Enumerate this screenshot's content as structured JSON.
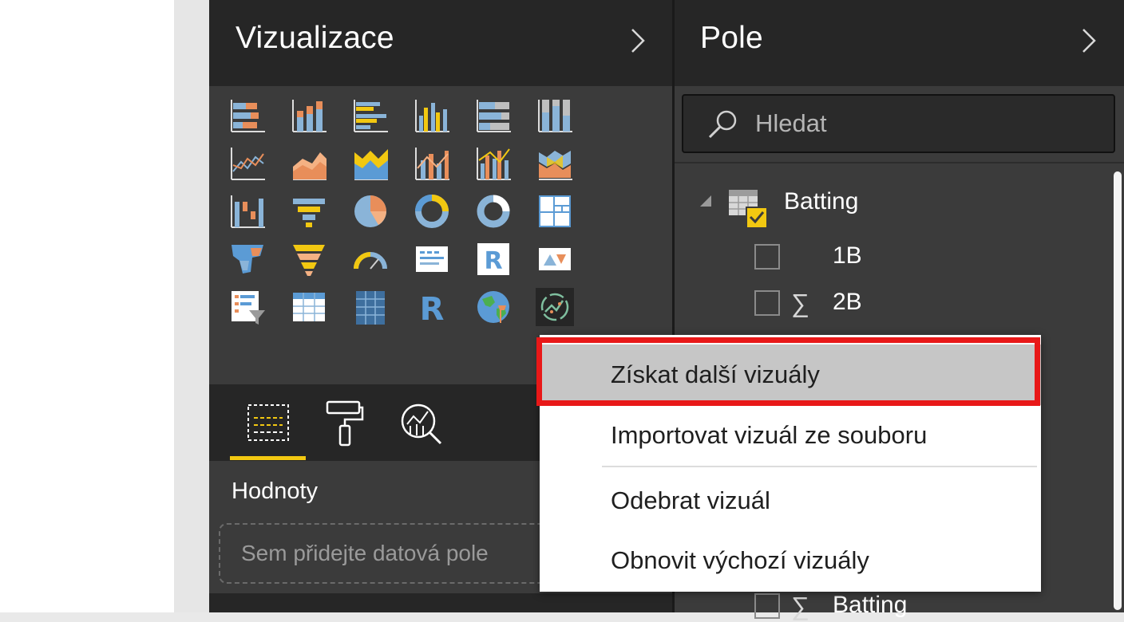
{
  "visualizations_pane": {
    "title": "Vizualizace",
    "more_label": "...",
    "icons": [
      "stacked-bar-chart-icon",
      "stacked-column-chart-icon",
      "clustered-bar-chart-icon",
      "clustered-column-chart-icon",
      "100-stacked-bar-chart-icon",
      "100-stacked-column-chart-icon",
      "line-chart-icon",
      "area-chart-icon",
      "stacked-area-chart-icon",
      "line-and-stacked-column-chart-icon",
      "line-and-clustered-column-chart-icon",
      "ribbon-chart-icon",
      "waterfall-chart-icon",
      "funnel-chart-icon",
      "pie-chart-icon",
      "donut-chart-icon",
      "treemap-icon",
      "map-icon",
      "filled-map-icon",
      "funnel-icon",
      "gauge-icon",
      "card-icon",
      "multi-row-card-icon",
      "kpi-icon",
      "slicer-icon",
      "table-icon",
      "matrix-icon",
      "r-visual-icon",
      "globe-map-icon",
      "custom-visual-icon"
    ],
    "tabs": [
      "fields-tab-icon",
      "format-tab-icon",
      "analytics-tab-icon"
    ],
    "values_section": {
      "title": "Hodnoty",
      "placeholder": "Sem přidejte datová pole"
    }
  },
  "fields_pane": {
    "title": "Pole",
    "search": {
      "placeholder": "Hledat"
    },
    "table": {
      "name": "Batting",
      "fields": [
        {
          "name": "1B",
          "aggregate": ""
        },
        {
          "name": "2B",
          "aggregate": "∑"
        },
        {
          "name": "Batting",
          "aggregate": "∑"
        }
      ]
    }
  },
  "context_menu": {
    "items": [
      "Získat další vizuály",
      "Importovat vizuál ze souboru",
      "Odebrat vizuál",
      "Obnovit výchozí vizuály"
    ],
    "highlighted_index": 0
  },
  "colors": {
    "accent": "#f2c811",
    "highlight_frame": "#e81818",
    "pane_bg": "#3b3b3b",
    "header_bg": "#262626"
  }
}
